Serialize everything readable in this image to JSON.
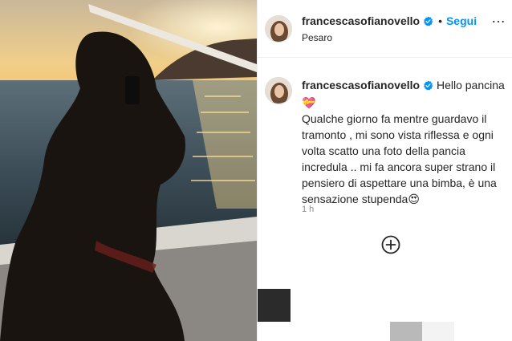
{
  "post": {
    "username": "francescasofianovello",
    "verified": true,
    "follow_label": "Segui",
    "separator": "•",
    "more_label": "…",
    "location": "Pesaro",
    "caption_lead": "Hello pancina",
    "caption_emoji": "💝",
    "caption_body": "Qualche giorno fa mentre guardavo il tramonto , mi sono vista riflessa e ogni volta scatto una foto della pancia incredula .. mi fa ancora super strano il pensiero di aspettare una bimba, è una sensazione stupenda😍",
    "timestamp": "1 h"
  },
  "icons": {
    "verified": "verified-badge-icon",
    "add_comment": "plus-circle-icon",
    "more": "more-options-icon"
  },
  "colors": {
    "accent": "#0095f6",
    "text": "#262626",
    "muted": "#8e8e8e",
    "border": "#efefef"
  }
}
